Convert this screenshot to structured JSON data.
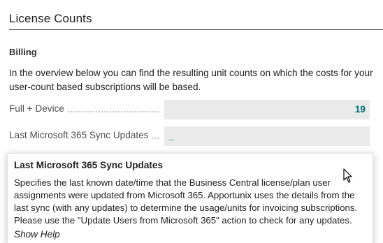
{
  "section": {
    "title": "License Counts"
  },
  "billing": {
    "group_title": "Billing",
    "description": "In the overview below you can find the resulting unit counts on which the costs for your user-count based subscriptions will be based.",
    "fields": [
      {
        "label": "Full + Device",
        "value": "19"
      },
      {
        "label": "Last Microsoft 365 Sync Updates",
        "value": "_"
      }
    ]
  },
  "tooltip": {
    "title": "Last Microsoft 365 Sync Updates",
    "body": "Specifies the last known date/time that the Business Central license/plan user assignments were updated from Microsoft 365. Apportunix uses the details from the last sync (with any updates) to determine the usage/units for invoicing subscriptions. Please use the \"Update Users from Microsoft 365\" action to check for any updates.",
    "link": "Show Help"
  },
  "colors": {
    "accent": "#00707a",
    "field_background": "#eaeaea"
  },
  "icons": {
    "cursor": "mouse-pointer-icon"
  }
}
